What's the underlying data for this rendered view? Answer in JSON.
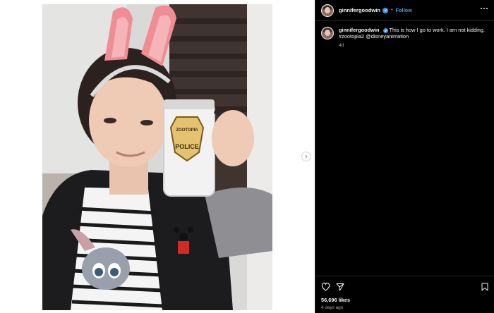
{
  "post": {
    "username": "ginnifergoodwin",
    "follow_label": "Follow",
    "separator": "•",
    "caption": "This is how I go to work. I am not kidding. #zootopia2 @disneyanimation",
    "relative_time": "4d",
    "likes": "56,696 likes",
    "posted_ago": "4 days ago"
  },
  "mug": {
    "badge_top": "ZOOTOPIA",
    "badge_bottom": "POLICE"
  },
  "icons": {
    "verified": "verified-badge-icon",
    "more": "more-options-icon",
    "like": "heart-icon",
    "share": "paper-plane-icon",
    "save": "bookmark-icon",
    "next": "chevron-right-icon"
  },
  "colors": {
    "panel_bg": "#000000",
    "follow": "#3797ef",
    "verified": "#3897f0"
  }
}
